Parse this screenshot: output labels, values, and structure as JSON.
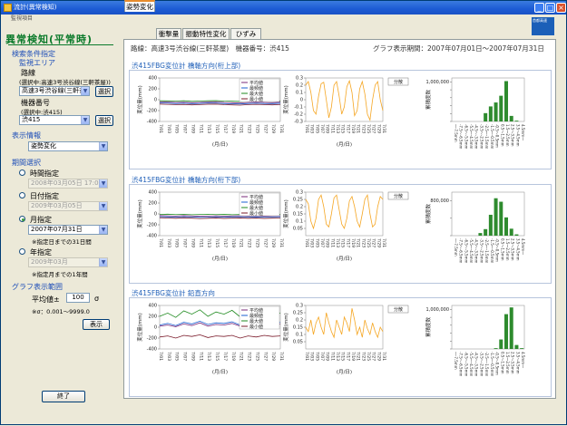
{
  "window": {
    "title": "流計(異常検知)"
  },
  "menu": {
    "label": "監視項目"
  },
  "left": {
    "heading": "異常検知(平常時)",
    "search_section": "検索条件指定",
    "area_label": "監視エリア",
    "route_label": "路線",
    "route_selected_note": "(選択中:高速3号渋谷線(三軒茶屋))",
    "route_value": "高速3号渋谷線(三軒茶屋)",
    "select_button": "選択",
    "device_label": "機器番号",
    "device_selected_note": "(選択中:渋415)",
    "device_value": "渋415",
    "display_section": "表示情報",
    "display_value": "姿勢変化",
    "period_section": "期間選択",
    "time_label": "時間指定",
    "time_value": "2008年03月05日 17:00",
    "day_label": "日付指定",
    "day_value": "2009年03月05日",
    "month_label": "月指定",
    "month_value": "2007年07月31日",
    "month_note": "※指定日までの31日間",
    "year_label": "年指定",
    "year_value": "2009年03月",
    "year_note": "※指定月までの1年間",
    "range_section": "グラフ表示範囲",
    "mean_label": "平均値±",
    "mean_value": "100",
    "sigma": "σ",
    "sigma_note": "※σ：0.001〜9999.0",
    "show_button": "表示",
    "exit_button": "終了"
  },
  "tabs": [
    "姿勢変化",
    "衝撃量",
    "振動特性変化",
    "ひずみ"
  ],
  "header": {
    "route_info": "路線：高速3号渋谷線(三軒茶屋)　機器番号：渋415",
    "period_info": "グラフ表示期間：2007年07月01日〜2007年07月31日",
    "logo": "首都高速"
  },
  "legend": [
    "平均値",
    "最頻値",
    "最大値",
    "最小値"
  ],
  "colors": {
    "mean": "#7a2a7a",
    "mode": "#1a5fd0",
    "max": "#1f8a1f",
    "min": "#7a1a2a",
    "orange": "#f5a623",
    "bar": "#2e8b2e",
    "accent": "#0a7a2a"
  },
  "x_dates": [
    "7/01",
    "7/03",
    "7/05",
    "7/07",
    "7/09",
    "7/11",
    "7/13",
    "7/15",
    "7/17",
    "7/19",
    "7/21",
    "7/23",
    "7/25",
    "7/27",
    "7/29",
    "7/31"
  ],
  "x_label": "(月/日)",
  "y_label_line": "変位量(mm)",
  "y_label_bar": "累積度数",
  "dist_button": "分散",
  "bins": [
    "〜-7.5mm",
    "-7.5〜-6.5mm",
    "-6.5〜-5.5mm",
    "-5.5〜-4.5mm",
    "-4.5〜-3.5mm",
    "-3.5〜-2.5mm",
    "-2.5〜-1.5mm",
    "-1.5〜-0.5mm",
    "-0.5〜0.5mm",
    "0.5〜1.5mm",
    "1.5〜2.5mm",
    "2.5〜3.5mm",
    "3.5〜4.5mm",
    "4.5mm〜"
  ],
  "rows": [
    {
      "title": "渋415FBG変位計 橋軸方向(桁上部)"
    },
    {
      "title": "渋415FBG変位計 橋軸方向(桁下部)"
    },
    {
      "title": "渋415FBG変位計 鉛直方向"
    }
  ],
  "chart_data": [
    {
      "type": "line",
      "title": "",
      "ylim": [
        -400,
        400
      ],
      "yticks": [
        -400,
        -200,
        0,
        200,
        400
      ],
      "series": [
        {
          "name": "平均値",
          "values": [
            -40,
            -45,
            -50,
            -48,
            -55,
            -50,
            -45,
            -40,
            -50,
            -55,
            -60,
            -50,
            -45,
            -50,
            -55,
            -45
          ]
        },
        {
          "name": "最頻値",
          "values": [
            -60,
            -62,
            -70,
            -65,
            -72,
            -68,
            -60,
            -62,
            -70,
            -75,
            -78,
            -70,
            -64,
            -70,
            -72,
            -66
          ]
        },
        {
          "name": "最大値",
          "values": [
            -20,
            -22,
            -25,
            -20,
            -30,
            -25,
            -20,
            -18,
            -25,
            -28,
            -32,
            -24,
            -20,
            -25,
            -28,
            -22
          ]
        },
        {
          "name": "最小値",
          "values": [
            -80,
            -85,
            -90,
            -88,
            -95,
            -90,
            -82,
            -80,
            -90,
            -95,
            -100,
            -90,
            -85,
            -90,
            -95,
            -88
          ]
        }
      ]
    },
    {
      "type": "line",
      "ylim": [
        -0.3,
        0.3
      ],
      "yticks": [
        -0.3,
        -0.2,
        -0.1,
        0,
        0.1,
        0.2,
        0.3
      ],
      "values": [
        0.2,
        0.25,
        0.1,
        -0.15,
        -0.2,
        0.05,
        0.22,
        0.24,
        0.0,
        -0.25,
        -0.1,
        0.2,
        0.25,
        0.05,
        -0.2,
        -0.1,
        0.18,
        0.26,
        0.1,
        -0.22,
        -0.15,
        0.15,
        0.25,
        0.08,
        -0.2,
        -0.28,
        0.0,
        0.2,
        0.25,
        0.0,
        -0.15
      ]
    },
    {
      "type": "bar",
      "yticks": [
        0,
        200000,
        400000,
        600000,
        800000,
        1000000
      ],
      "ytick_labels": [
        "",
        "",
        "",
        "",
        "",
        "1,000,000"
      ],
      "ylim": [
        0,
        1100000
      ],
      "values": [
        0,
        0,
        0,
        0,
        0,
        0,
        210000,
        380000,
        480000,
        650000,
        1020000,
        140000,
        20000,
        0
      ]
    },
    {
      "type": "line",
      "ylim": [
        -400,
        400
      ],
      "yticks": [
        -400,
        -200,
        0,
        200,
        400
      ],
      "series": [
        {
          "name": "平均値",
          "values": [
            -30,
            -35,
            -40,
            -32,
            -38,
            -45,
            -40,
            -35,
            -42,
            -38,
            -34,
            -40,
            -36,
            -42,
            -38,
            -35
          ]
        },
        {
          "name": "最頻値",
          "values": [
            -50,
            -55,
            -58,
            -52,
            -56,
            -62,
            -60,
            -54,
            -58,
            -55,
            -52,
            -58,
            -55,
            -60,
            -56,
            -52
          ]
        },
        {
          "name": "最大値",
          "values": [
            -10,
            -5,
            -12,
            -8,
            -15,
            -10,
            -6,
            -12,
            -9,
            -14,
            -10,
            -8,
            -12,
            -6,
            -10,
            -8
          ]
        },
        {
          "name": "最小値",
          "values": [
            -70,
            -75,
            -80,
            -72,
            -78,
            -85,
            -80,
            -74,
            -82,
            -78,
            -74,
            -80,
            -76,
            -82,
            -78,
            -75
          ]
        }
      ]
    },
    {
      "type": "line",
      "ylim": [
        0,
        0.3
      ],
      "yticks": [
        0.05,
        0.1,
        0.15,
        0.2,
        0.25,
        0.3
      ],
      "values": [
        0.25,
        0.22,
        0.1,
        0.05,
        0.12,
        0.25,
        0.28,
        0.2,
        0.08,
        0.06,
        0.15,
        0.26,
        0.28,
        0.18,
        0.08,
        0.05,
        0.12,
        0.24,
        0.27,
        0.2,
        0.1,
        0.06,
        0.15,
        0.25,
        0.28,
        0.15,
        0.06,
        0.08,
        0.2,
        0.27,
        0.25
      ]
    },
    {
      "type": "bar",
      "yticks": [
        0,
        400000,
        800000
      ],
      "ytick_labels": [
        "",
        "",
        "800,000"
      ],
      "ylim": [
        0,
        1000000
      ],
      "values": [
        0,
        0,
        0,
        0,
        0,
        60000,
        150000,
        480000,
        860000,
        780000,
        420000,
        160000,
        30000,
        0
      ]
    },
    {
      "type": "line",
      "ylim": [
        -400,
        400
      ],
      "yticks": [
        -400,
        -200,
        0,
        200,
        400
      ],
      "series": [
        {
          "name": "平均値",
          "values": [
            20,
            40,
            10,
            60,
            30,
            80,
            20,
            50,
            40,
            70,
            20,
            60,
            30,
            80,
            40,
            60
          ]
        },
        {
          "name": "最頻値",
          "values": [
            40,
            70,
            30,
            90,
            60,
            110,
            50,
            80,
            70,
            100,
            40,
            90,
            60,
            110,
            70,
            90
          ]
        },
        {
          "name": "最大値",
          "values": [
            200,
            260,
            180,
            300,
            240,
            320,
            200,
            280,
            240,
            310,
            190,
            270,
            220,
            300,
            230,
            260
          ]
        },
        {
          "name": "最小値",
          "values": [
            -180,
            -160,
            -200,
            -150,
            -170,
            -140,
            -190,
            -160,
            -170,
            -150,
            -200,
            -160,
            -180,
            -150,
            -170,
            -160
          ]
        }
      ]
    },
    {
      "type": "line",
      "ylim": [
        0,
        0.3
      ],
      "yticks": [
        0.05,
        0.1,
        0.15,
        0.2,
        0.25,
        0.3
      ],
      "values": [
        0.15,
        0.12,
        0.2,
        0.1,
        0.18,
        0.22,
        0.15,
        0.1,
        0.25,
        0.18,
        0.12,
        0.08,
        0.2,
        0.15,
        0.1,
        0.22,
        0.18,
        0.12,
        0.28,
        0.2,
        0.1,
        0.15,
        0.08,
        0.2,
        0.14,
        0.1,
        0.18,
        0.12,
        0.08,
        0.15,
        0.12
      ]
    },
    {
      "type": "bar",
      "yticks": [
        0,
        200000,
        400000,
        600000,
        800000,
        1000000
      ],
      "ytick_labels": [
        "",
        "",
        "",
        "",
        "",
        "1,000,000"
      ],
      "ylim": [
        0,
        1100000
      ],
      "values": [
        0,
        0,
        0,
        0,
        0,
        0,
        0,
        0,
        20000,
        240000,
        880000,
        1050000,
        100000,
        20000
      ]
    }
  ]
}
